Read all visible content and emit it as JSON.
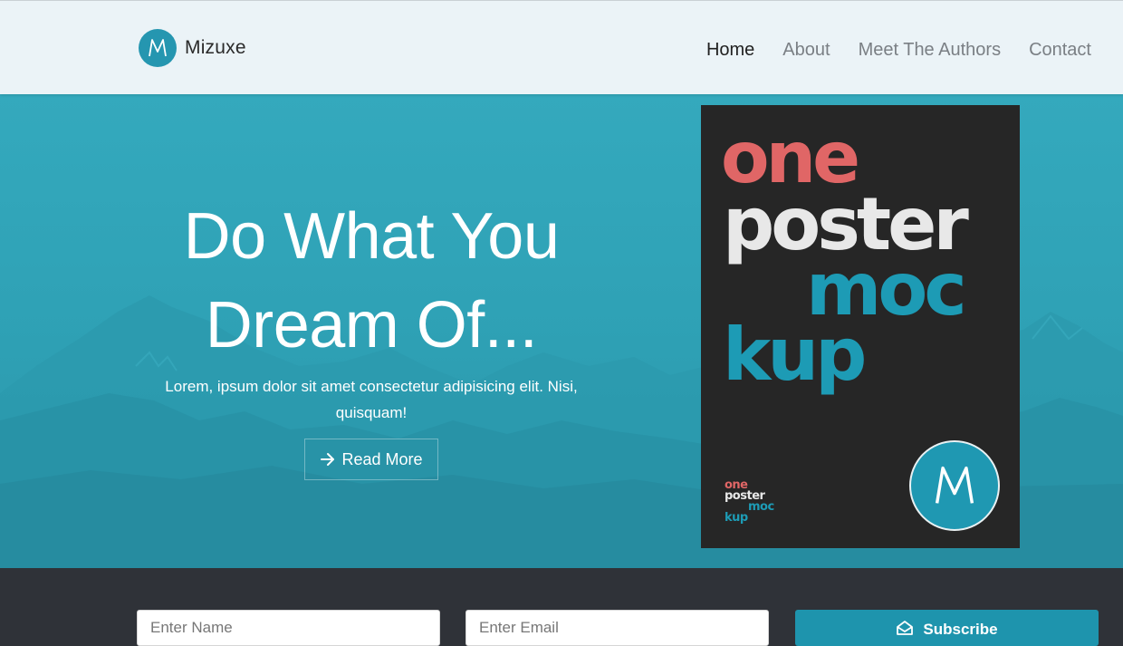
{
  "brand": {
    "name": "Mizuxe",
    "logo_letter": "M"
  },
  "nav": {
    "items": [
      {
        "label": "Home",
        "active": true
      },
      {
        "label": "About",
        "active": false
      },
      {
        "label": "Meet The Authors",
        "active": false
      },
      {
        "label": "Contact",
        "active": false
      }
    ]
  },
  "hero": {
    "title_line1": "Do What You",
    "title_line2": "Dream Of...",
    "text": "Lorem, ipsum dolor sit amet consectetur adipisicing elit. Nisi, quisquam!",
    "button_label": "Read More",
    "button_icon": "arrow-right-icon"
  },
  "poster": {
    "word1": "one",
    "word2": "poster",
    "word3": "moc",
    "word4": "kup",
    "logo_letter": "M",
    "colors": {
      "background": "#262626",
      "red": "#e06666",
      "light": "#e8e8e8",
      "teal": "#1d9bb5"
    }
  },
  "subscribe": {
    "name_placeholder": "Enter Name",
    "email_placeholder": "Enter Email",
    "button_label": "Subscribe",
    "button_icon": "envelope-open-icon"
  },
  "colors": {
    "accent": "#2596b0",
    "hero_bg": "#30a3b7",
    "navbar_bg": "#ebf3f7",
    "footer_bg": "#2f3238"
  }
}
